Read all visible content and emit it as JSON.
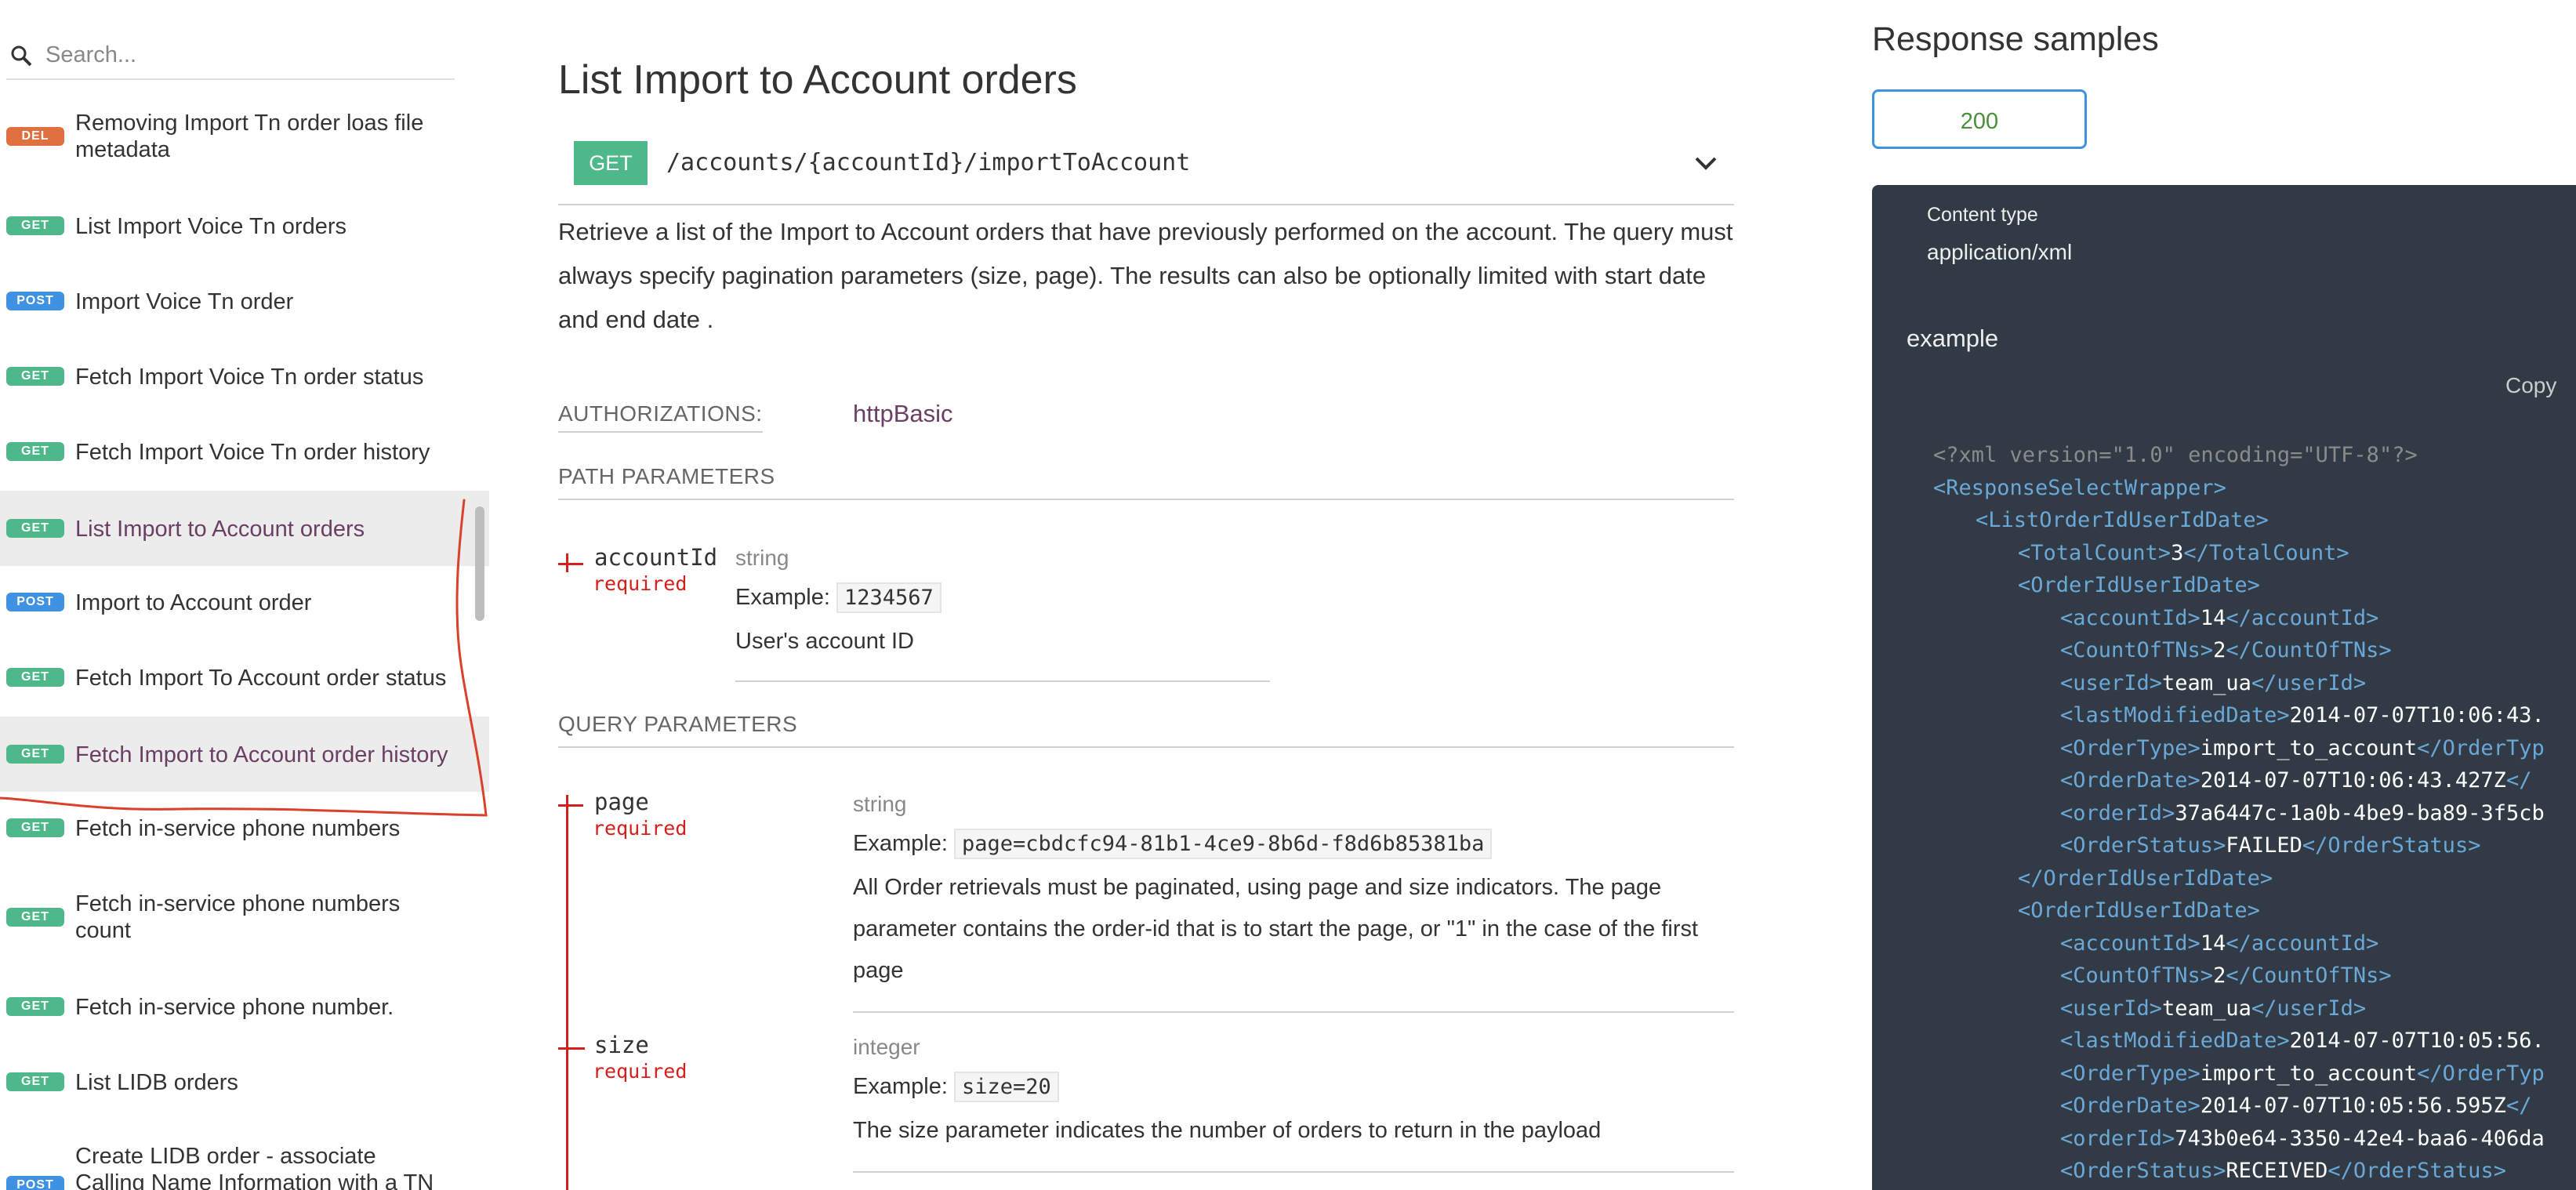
{
  "search": {
    "placeholder": "Search..."
  },
  "sidebar": {
    "items": [
      {
        "method": "DEL",
        "label": "Removing Import Tn order loas file metadata"
      },
      {
        "method": "GET",
        "label": "List Import Voice Tn orders"
      },
      {
        "method": "POST",
        "label": "Import Voice Tn order"
      },
      {
        "method": "GET",
        "label": "Fetch Import Voice Tn order status"
      },
      {
        "method": "GET",
        "label": "Fetch Import Voice Tn order history"
      },
      {
        "method": "GET",
        "label": "List Import to Account orders"
      },
      {
        "method": "POST",
        "label": "Import to Account order"
      },
      {
        "method": "GET",
        "label": "Fetch Import To Account order status"
      },
      {
        "method": "GET",
        "label": "Fetch Import to Account order history"
      },
      {
        "method": "GET",
        "label": "Fetch in-service phone numbers"
      },
      {
        "method": "GET",
        "label": "Fetch in-service phone numbers count"
      },
      {
        "method": "GET",
        "label": "Fetch in-service phone number."
      },
      {
        "method": "GET",
        "label": "List LIDB orders"
      },
      {
        "method": "POST",
        "label": "Create LIDB order - associate Calling Name Information with a TN or list of"
      }
    ]
  },
  "main": {
    "title": "List Import to Account orders",
    "method": "GET",
    "path": "/accounts/{accountId}/importToAccount",
    "description": "Retrieve a list of the Import to Account orders that have previously performed on the account. The query must always specify pagination parameters (size, page). The results can also be optionally limited with start date and end date .",
    "authorizations_label": "AUTHORIZATIONS:",
    "authorizations_value": "httpBasic",
    "path_params_label": "PATH PARAMETERS",
    "query_params_label": "QUERY PARAMETERS",
    "example_label": "Example:",
    "params": {
      "accountId": {
        "name": "accountId",
        "required": "required",
        "type": "string",
        "example": "1234567",
        "description": "User's account ID"
      },
      "page": {
        "name": "page",
        "required": "required",
        "type": "string",
        "example": "page=cbdcfc94-81b1-4ce9-8b6d-f8d6b85381ba",
        "description": "All Order retrievals must be paginated, using page and size indicators. The page parameter contains the order-id that is to start the page, or \"1\" in the case of the first page"
      },
      "size": {
        "name": "size",
        "required": "required",
        "type": "integer",
        "example": "size=20",
        "description": "The size parameter indicates the number of orders to return in the payload"
      }
    }
  },
  "response": {
    "title": "Response samples",
    "tab": "200",
    "content_type_label": "Content type",
    "content_type_value": "application/xml",
    "example_label": "example",
    "copy_label": "Copy",
    "code_lines": [
      {
        "indent": 0,
        "kind": "pi",
        "text": "<?xml version=\"1.0\" encoding=\"UTF-8\"?>"
      },
      {
        "indent": 0,
        "open": "<ResponseSelectWrapper>"
      },
      {
        "indent": 1,
        "open": "<ListOrderIdUserIdDate>"
      },
      {
        "indent": 2,
        "open": "<TotalCount>",
        "value": "3",
        "close": "</TotalCount>"
      },
      {
        "indent": 2,
        "open": "<OrderIdUserIdDate>"
      },
      {
        "indent": 3,
        "open": "<accountId>",
        "value": "14",
        "close": "</accountId>"
      },
      {
        "indent": 3,
        "open": "<CountOfTNs>",
        "value": "2",
        "close": "</CountOfTNs>"
      },
      {
        "indent": 3,
        "open": "<userId>",
        "value": "team_ua",
        "close": "</userId>"
      },
      {
        "indent": 3,
        "open": "<lastModifiedDate>",
        "value": "2014-07-07T10:06:43.",
        "close": ""
      },
      {
        "indent": 3,
        "open": "<OrderType>",
        "value": "import_to_account",
        "close": "</OrderTyp"
      },
      {
        "indent": 3,
        "open": "<OrderDate>",
        "value": "2014-07-07T10:06:43.427Z",
        "close": "</"
      },
      {
        "indent": 3,
        "open": "<orderId>",
        "value": "37a6447c-1a0b-4be9-ba89-3f5cb",
        "close": ""
      },
      {
        "indent": 3,
        "open": "<OrderStatus>",
        "value": "FAILED",
        "close": "</OrderStatus>"
      },
      {
        "indent": 2,
        "open": "</OrderIdUserIdDate>"
      },
      {
        "indent": 2,
        "open": "<OrderIdUserIdDate>"
      },
      {
        "indent": 3,
        "open": "<accountId>",
        "value": "14",
        "close": "</accountId>"
      },
      {
        "indent": 3,
        "open": "<CountOfTNs>",
        "value": "2",
        "close": "</CountOfTNs>"
      },
      {
        "indent": 3,
        "open": "<userId>",
        "value": "team_ua",
        "close": "</userId>"
      },
      {
        "indent": 3,
        "open": "<lastModifiedDate>",
        "value": "2014-07-07T10:05:56.",
        "close": ""
      },
      {
        "indent": 3,
        "open": "<OrderType>",
        "value": "import_to_account",
        "close": "</OrderTyp"
      },
      {
        "indent": 3,
        "open": "<OrderDate>",
        "value": "2014-07-07T10:05:56.595Z",
        "close": "</"
      },
      {
        "indent": 3,
        "open": "<orderId>",
        "value": "743b0e64-3350-42e4-baa6-406da",
        "close": ""
      },
      {
        "indent": 3,
        "open": "<OrderStatus>",
        "value": "RECEIVED",
        "close": "</OrderStatus>"
      }
    ]
  },
  "colors": {
    "get": "#4fb88a",
    "post": "#3f92e1",
    "del": "#e0703f",
    "accent": "#6b3e64",
    "required": "#d41f1c",
    "panel": "#323a45"
  }
}
